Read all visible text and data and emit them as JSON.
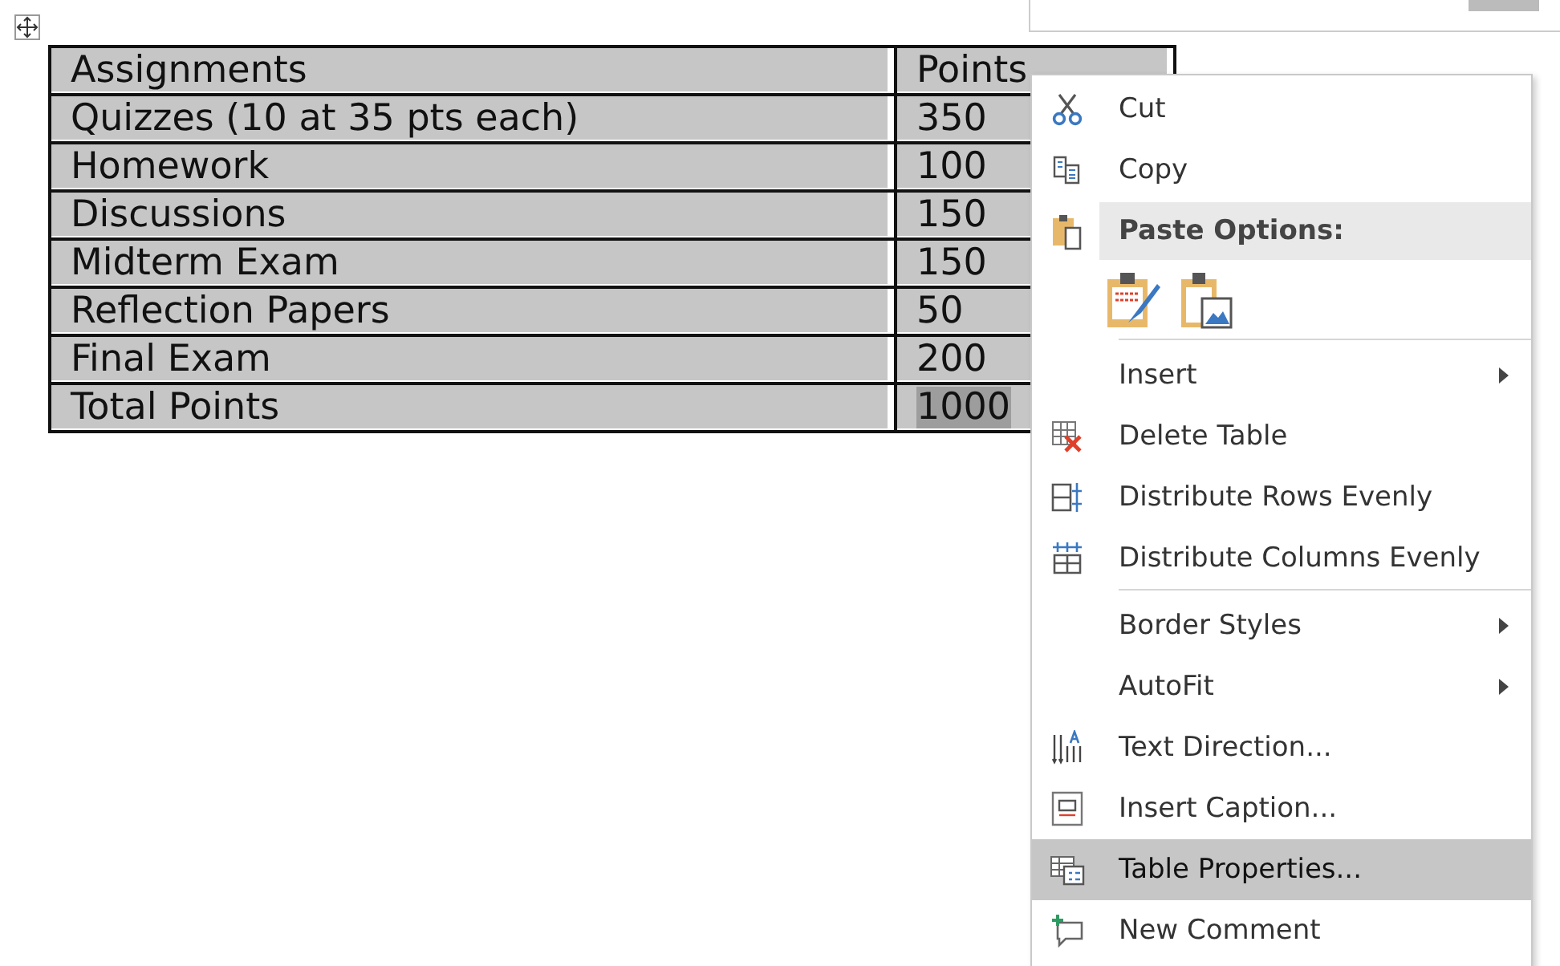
{
  "table": {
    "selected": true,
    "header": {
      "assignment": "Assignments",
      "points": "Points"
    },
    "rows": [
      {
        "assignment": "Quizzes (10 at 35 pts each)",
        "points": "350",
        "points_highlighted": false
      },
      {
        "assignment": "Homework",
        "points": "100",
        "points_highlighted": false
      },
      {
        "assignment": "Discussions",
        "points": "150",
        "points_highlighted": false
      },
      {
        "assignment": "Midterm Exam",
        "points": "150",
        "points_highlighted": false
      },
      {
        "assignment": "Reflection Papers",
        "points": "50",
        "points_highlighted": false
      },
      {
        "assignment": "Final Exam",
        "points": "200",
        "points_highlighted": false
      },
      {
        "assignment": "Total Points",
        "points": "1000",
        "points_highlighted": true
      }
    ]
  },
  "context_menu": {
    "items": [
      {
        "kind": "item",
        "label": "Cut",
        "selected": false,
        "submenu": false
      },
      {
        "kind": "item",
        "label": "Copy",
        "selected": false,
        "submenu": false
      },
      {
        "kind": "header",
        "label": "Paste Options:"
      },
      {
        "kind": "paste-icons"
      },
      {
        "kind": "item",
        "label": "Insert",
        "selected": false,
        "submenu": true,
        "separator_before": true
      },
      {
        "kind": "item",
        "label": "Delete Table",
        "selected": false,
        "submenu": false
      },
      {
        "kind": "item",
        "label": "Distribute Rows Evenly",
        "selected": false,
        "submenu": false
      },
      {
        "kind": "item",
        "label": "Distribute Columns Evenly",
        "selected": false,
        "submenu": false
      },
      {
        "kind": "item",
        "label": "Border Styles",
        "selected": false,
        "submenu": true,
        "separator_before": true
      },
      {
        "kind": "item",
        "label": "AutoFit",
        "selected": false,
        "submenu": true
      },
      {
        "kind": "item",
        "label": "Text Direction...",
        "selected": false,
        "submenu": false
      },
      {
        "kind": "item",
        "label": "Insert Caption...",
        "selected": false,
        "submenu": false
      },
      {
        "kind": "item",
        "label": "Table Properties...",
        "selected": true,
        "submenu": false
      },
      {
        "kind": "item",
        "label": "New Comment",
        "selected": false,
        "submenu": false
      }
    ]
  }
}
